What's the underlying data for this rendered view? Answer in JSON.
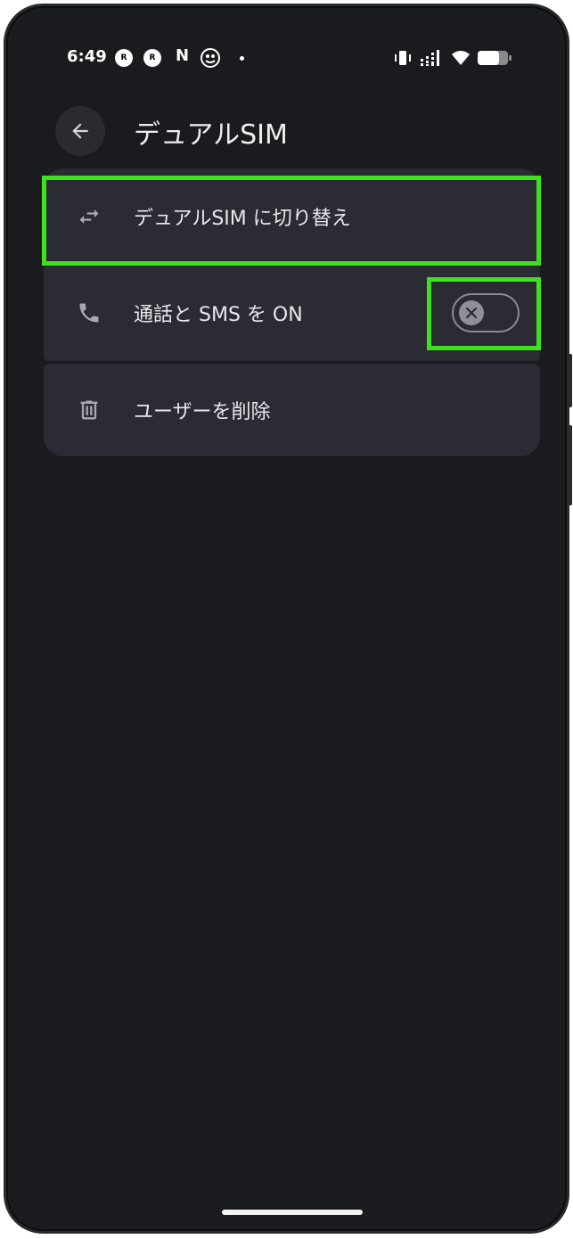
{
  "status_bar": {
    "time": "6:49",
    "left_icons": [
      "rakuten-link-icon",
      "rakuten-link-icon",
      "netflix-icon",
      "app-icon",
      "notification-dot-icon"
    ],
    "right_icons": [
      "vibrate-icon",
      "signal-icon",
      "wifi-icon",
      "battery-icon"
    ],
    "badge_letter": "R",
    "n_letter": "N"
  },
  "header": {
    "title": "デュアルSIM"
  },
  "settings": {
    "items": [
      {
        "label": "デュアルSIM に切り替え",
        "icon": "swap-arrows-icon"
      },
      {
        "label": "通話と SMS を ON",
        "icon": "phone-icon",
        "toggle_state": "off"
      },
      {
        "label": "ユーザーを削除",
        "icon": "trash-icon"
      }
    ]
  },
  "colors": {
    "background": "#1a1b1f",
    "card": "#2a2b33",
    "highlight": "#3de11c",
    "text": "#e8e8ec"
  }
}
